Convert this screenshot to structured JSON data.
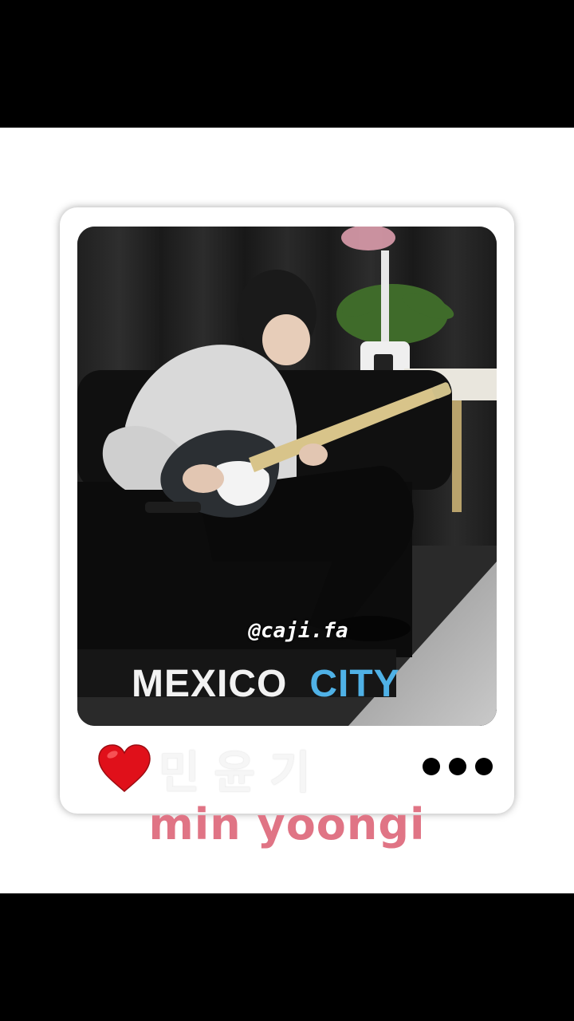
{
  "post": {
    "watermark": "@caji.fa",
    "location_word1": "MEXICO",
    "location_word2": "CITY",
    "korean_name": "민윤기",
    "caption": "min yoongi"
  },
  "icons": {
    "like": "heart-icon",
    "more": "more-dots-icon"
  },
  "colors": {
    "heart": "#e0101a",
    "caption": "#e07485",
    "city": "#4fb1e6"
  }
}
